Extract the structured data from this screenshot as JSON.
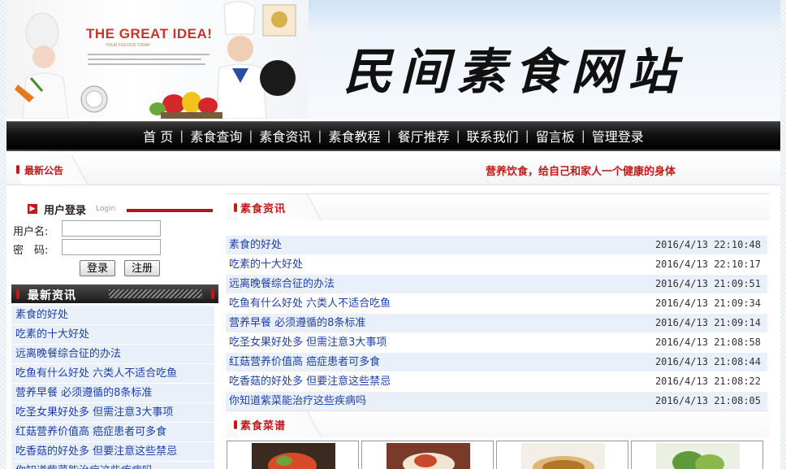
{
  "site": {
    "title": "民间素食网站",
    "banner_slogan": "THE GREAT IDEA!",
    "banner_sub": "YOUR FGFOOD TODAY"
  },
  "nav": {
    "items": [
      "首 页",
      "素食查询",
      "素食资讯",
      "素食教程",
      "餐厅推荐",
      "联系我们",
      "留言板",
      "管理登录"
    ]
  },
  "notice": {
    "label": "最新公告",
    "text": "营养饮食，给自己和家人一个健康的身体"
  },
  "login": {
    "title": "用户登录",
    "subtitle": "Login",
    "username_label": "用户名:",
    "password_label": "密　码:",
    "login_button": "登录",
    "register_button": "注册"
  },
  "latest": {
    "title": "最新资讯",
    "items": [
      "素食的好处",
      "吃素的十大好处",
      "远离晚餐综合征的办法",
      "吃鱼有什么好处 六类人不适合吃鱼",
      "营养早餐 必须遵循的8条标准",
      "吃圣女果好处多 但需注意3大事项",
      "红菇营养价值高 癌症患者可多食",
      "吃香菇的好处多 但要注意这些禁忌",
      "你知道紫菜能治疗这些疾病吗"
    ]
  },
  "news": {
    "title": "素食资讯",
    "rows": [
      {
        "title": "素食的好处",
        "date": "2016/4/13 22:10:48"
      },
      {
        "title": "吃素的十大好处",
        "date": "2016/4/13 22:10:17"
      },
      {
        "title": "远离晚餐综合征的办法",
        "date": "2016/4/13 21:09:51"
      },
      {
        "title": "吃鱼有什么好处 六类人不适合吃鱼",
        "date": "2016/4/13 21:09:34"
      },
      {
        "title": "营养早餐 必须遵循的8条标准",
        "date": "2016/4/13 21:09:14"
      },
      {
        "title": "吃圣女果好处多 但需注意3大事项",
        "date": "2016/4/13 21:08:58"
      },
      {
        "title": "红菇营养价值高 癌症患者可多食",
        "date": "2016/4/13 21:08:44"
      },
      {
        "title": "吃香菇的好处多 但要注意这些禁忌",
        "date": "2016/4/13 21:08:22"
      },
      {
        "title": "你知道紫菜能治疗这些疾病吗",
        "date": "2016/4/13 21:08:05"
      }
    ]
  },
  "recipes": {
    "title": "素食菜谱"
  },
  "colors": {
    "accent_red": "#c0191b",
    "link_blue": "#1f3fa6",
    "row_bg": "#e9f0f9"
  }
}
